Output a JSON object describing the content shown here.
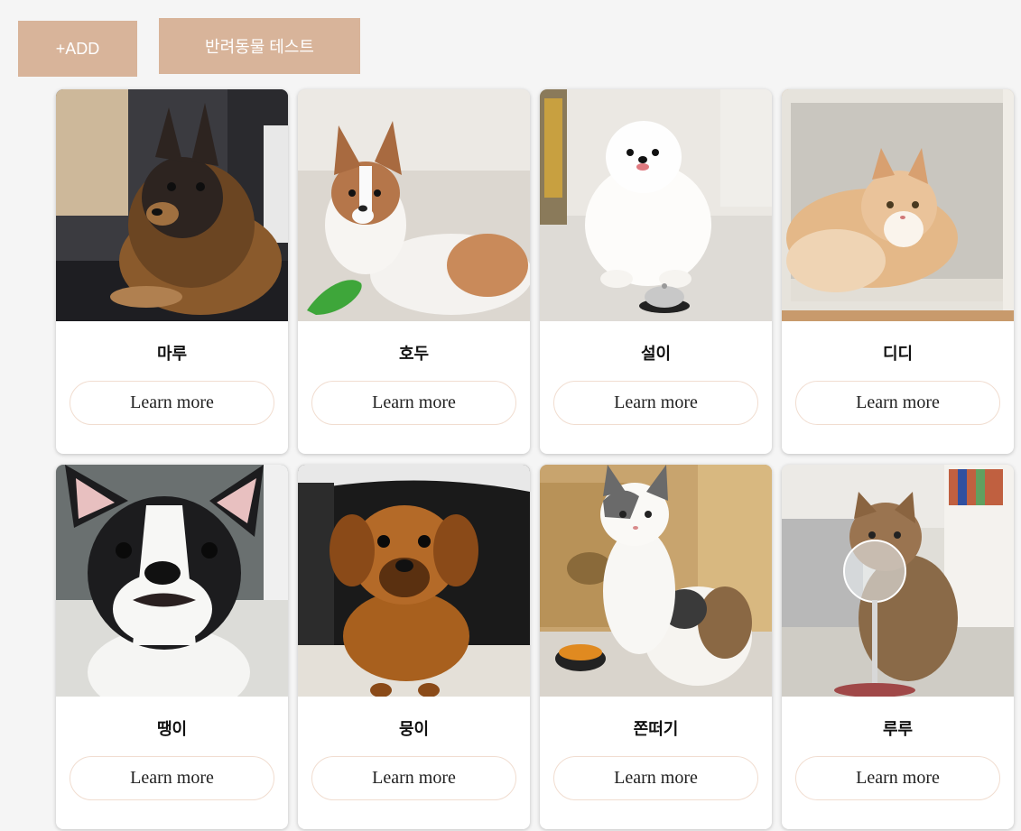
{
  "toolbar": {
    "add_label": "+ADD",
    "test_label": "반려동물 테스트"
  },
  "colors": {
    "accent": "#d8b49a",
    "background": "#f5f5f5",
    "card": "#ffffff",
    "button_border": "#f1ddd0"
  },
  "pets": [
    {
      "name": "마루",
      "button": "Learn more",
      "photo": "dog-photo"
    },
    {
      "name": "호두",
      "button": "Learn more",
      "photo": "dog-photo"
    },
    {
      "name": "설이",
      "button": "Learn more",
      "photo": "dog-photo"
    },
    {
      "name": "디디",
      "button": "Learn more",
      "photo": "cat-photo"
    },
    {
      "name": "땡이",
      "button": "Learn more",
      "photo": "dog-photo"
    },
    {
      "name": "뭉이",
      "button": "Learn more",
      "photo": "dog-photo"
    },
    {
      "name": "쫀떠기",
      "button": "Learn more",
      "photo": "cat-photo"
    },
    {
      "name": "루루",
      "button": "Learn more",
      "photo": "cat-photo"
    }
  ]
}
